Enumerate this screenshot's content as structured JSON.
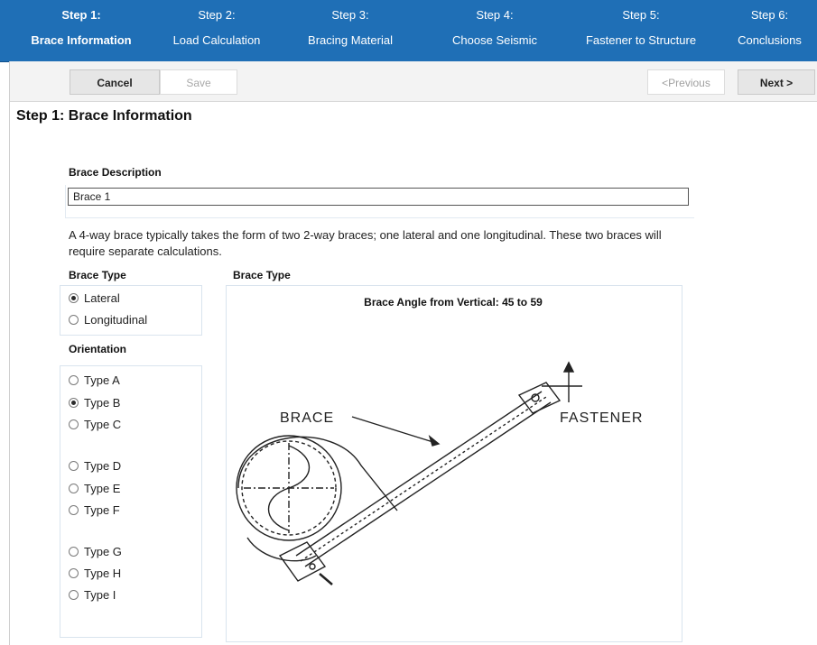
{
  "wizard": {
    "steps": [
      {
        "number": "Step 1:",
        "name": "Brace Information",
        "active": true
      },
      {
        "number": "Step 2:",
        "name": "Load Calculation",
        "active": false
      },
      {
        "number": "Step 3:",
        "name": "Bracing Material",
        "active": false
      },
      {
        "number": "Step 4:",
        "name": "Choose Seismic",
        "active": false
      },
      {
        "number": "Step 5:",
        "name": "Fastener to Structure",
        "active": false
      },
      {
        "number": "Step 6:",
        "name": "Conclusions",
        "active": false
      }
    ],
    "bg_color": "#1f6fb6"
  },
  "toolbar": {
    "cancel": "Cancel",
    "save": "Save",
    "previous": "<Previous",
    "next": "Next >"
  },
  "page": {
    "title": "Step 1: Brace Information"
  },
  "form": {
    "description_label": "Brace Description",
    "description_value": "Brace 1",
    "info_text": "A 4-way brace typically takes the form of two 2-way braces; one lateral and one longitudinal. These two braces will require separate calculations.",
    "brace_type_label": "Brace Type",
    "brace_types": [
      {
        "label": "Lateral",
        "checked": true
      },
      {
        "label": "Longitudinal",
        "checked": false
      }
    ],
    "orientation_label": "Orientation",
    "orientations": [
      {
        "label": "Type A",
        "checked": false
      },
      {
        "label": "Type B",
        "checked": true
      },
      {
        "label": "Type C",
        "checked": false
      },
      {
        "label": "Type D",
        "checked": false
      },
      {
        "label": "Type E",
        "checked": false
      },
      {
        "label": "Type F",
        "checked": false
      },
      {
        "label": "Type G",
        "checked": false
      },
      {
        "label": "Type H",
        "checked": false
      },
      {
        "label": "Type I",
        "checked": false
      }
    ]
  },
  "diagram": {
    "heading": "Brace Type",
    "title": "Brace Angle from Vertical: 45 to 59",
    "brace_label": "BRACE",
    "fastener_label": "FASTENER"
  }
}
